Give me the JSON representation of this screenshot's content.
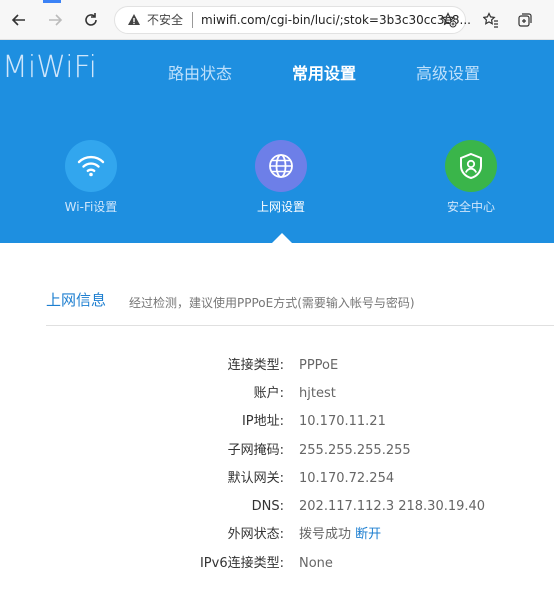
{
  "browser": {
    "insecure_label": "不安全",
    "url": "miwifi.com/cgi-bin/luci/;stok=3b3c30cc3e8..."
  },
  "header": {
    "logo": "MiWiFi",
    "nav": [
      "路由状态",
      "常用设置",
      "高级设置"
    ],
    "active_nav": "常用设置"
  },
  "subnav": [
    {
      "label": "Wi-Fi设置",
      "icon": "wifi-icon",
      "color": "#32a6ee"
    },
    {
      "label": "上网设置",
      "icon": "globe-icon",
      "color": "#6d7fe8"
    },
    {
      "label": "安全中心",
      "icon": "shield-user-icon",
      "color": "#3ab54a"
    }
  ],
  "section": {
    "title": "上网信息",
    "desc": "经过检测，建议使用PPPoE方式(需要输入帐号与密码)"
  },
  "info": [
    {
      "label": "连接类型:",
      "value": "PPPoE"
    },
    {
      "label": "账户:",
      "value": "hjtest"
    },
    {
      "label": "IP地址:",
      "value": "10.170.11.21"
    },
    {
      "label": "子网掩码:",
      "value": "255.255.255.255"
    },
    {
      "label": "默认网关:",
      "value": "10.170.72.254"
    },
    {
      "label": "DNS:",
      "value": "202.117.112.3 218.30.19.40"
    },
    {
      "label": "外网状态:",
      "value": "拨号成功",
      "action": "断开"
    },
    {
      "label": "IPv6连接类型:",
      "value": "None"
    }
  ],
  "colors": {
    "header_bg": "#1e8fe0",
    "link": "#1e7fd0"
  }
}
